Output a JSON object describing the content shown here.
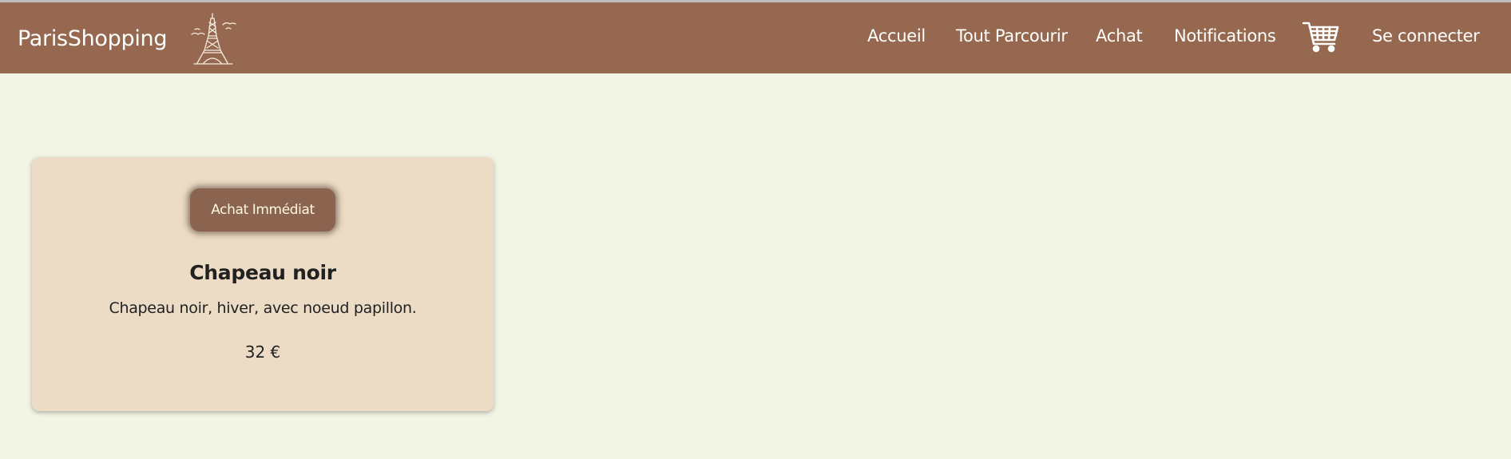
{
  "navbar": {
    "brand": "ParisShopping",
    "logo_icon": "eiffel-tower-icon",
    "links": {
      "accueil": "Accueil",
      "tout_parcourir": "Tout Parcourir",
      "achat": "Achat",
      "notifications": "Notifications",
      "se_connecter": "Se connecter"
    },
    "cart_icon": "shopping-cart-icon"
  },
  "product": {
    "button_label": "Achat Immédiat",
    "title": "Chapeau noir",
    "description": "Chapeau noir, hiver, avec noeud papillon.",
    "price": "32 €"
  },
  "colors": {
    "navbar_bg": "#96684f",
    "page_bg": "#f2f4e6",
    "card_bg": "#eddcc5",
    "button_bg": "#8b6450",
    "button_text": "#fff6da"
  }
}
